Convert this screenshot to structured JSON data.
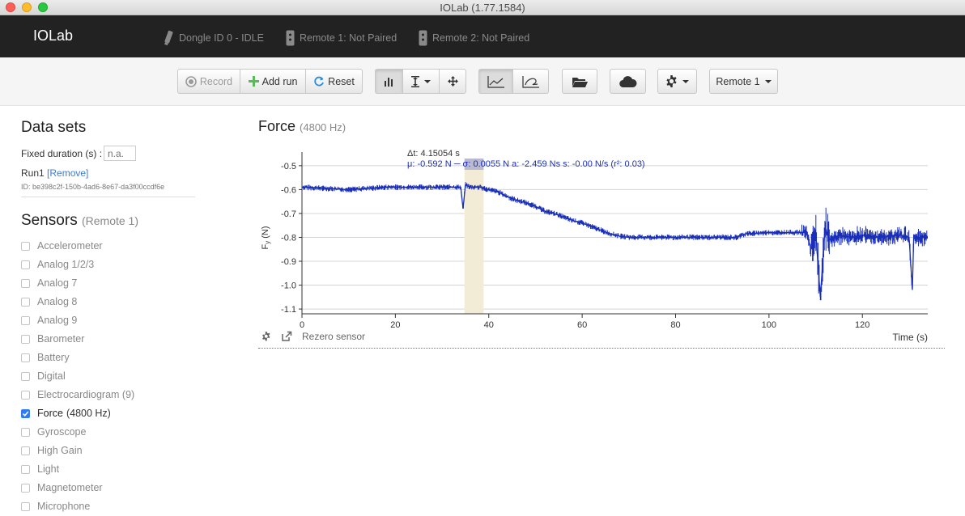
{
  "window": {
    "title": "IOLab (1.77.1584)"
  },
  "navbar": {
    "brand": "IOLab",
    "dongle": "Dongle ID 0 - IDLE",
    "remote1": "Remote 1: Not Paired",
    "remote2": "Remote 2: Not Paired"
  },
  "toolbar": {
    "record": "Record",
    "add_run": "Add run",
    "reset": "Reset",
    "remote_select": "Remote 1"
  },
  "datasets": {
    "heading": "Data sets",
    "fixed_duration_label": "Fixed duration (s) :",
    "fixed_duration_placeholder": "n.a.",
    "run_name": "Run1",
    "remove_link": "[Remove]",
    "run_id": "ID: be398c2f-150b-4ad6-8e67-da3f00ccdf6e"
  },
  "sensors": {
    "heading": "Sensors",
    "subheading": "(Remote 1)",
    "items": [
      {
        "name": "Accelerometer",
        "checked": false,
        "rate": ""
      },
      {
        "name": "Analog 1/2/3",
        "checked": false,
        "rate": ""
      },
      {
        "name": "Analog 7",
        "checked": false,
        "rate": ""
      },
      {
        "name": "Analog 8",
        "checked": false,
        "rate": ""
      },
      {
        "name": "Analog 9",
        "checked": false,
        "rate": ""
      },
      {
        "name": "Barometer",
        "checked": false,
        "rate": ""
      },
      {
        "name": "Battery",
        "checked": false,
        "rate": ""
      },
      {
        "name": "Digital",
        "checked": false,
        "rate": ""
      },
      {
        "name": "Electrocardiogram (9)",
        "checked": false,
        "rate": ""
      },
      {
        "name": "Force",
        "checked": true,
        "rate": "(4800 Hz)"
      },
      {
        "name": "Gyroscope",
        "checked": false,
        "rate": ""
      },
      {
        "name": "High Gain",
        "checked": false,
        "rate": ""
      },
      {
        "name": "Light",
        "checked": false,
        "rate": ""
      },
      {
        "name": "Magnetometer",
        "checked": false,
        "rate": ""
      },
      {
        "name": "Microphone",
        "checked": false,
        "rate": ""
      }
    ]
  },
  "plot": {
    "title": "Force",
    "rate": "(4800 Hz)",
    "rezero_label": "Rezero sensor",
    "stats_dt": "Δt: 4.15054 s",
    "stats_line": "μ: -0.592 N  ─  σ: 0.0055 N    a: -2.459 Ns    s: -0.00 N/s (r²: 0.03)"
  },
  "chart_data": {
    "type": "line",
    "xlabel": "Time (s)",
    "ylabel": "F",
    "ylabel_subscript": "y",
    "ylabel_unit": "(N)",
    "xlim": [
      0,
      134
    ],
    "ylim": [
      -1.12,
      -0.47
    ],
    "x_ticks": [
      0,
      20,
      40,
      60,
      80,
      100,
      120
    ],
    "y_ticks": [
      -0.5,
      -0.6,
      -0.7,
      -0.8,
      -0.9,
      -1.0,
      -1.1
    ],
    "grid": true,
    "line_color": "#1a2fb8",
    "selection": {
      "x_start": 34.8,
      "x_end": 38.9
    },
    "series": [
      {
        "x": [
          0,
          10,
          18,
          20,
          28,
          32,
          34,
          34.5,
          35,
          36,
          38,
          40,
          42,
          44,
          46,
          48,
          50,
          52,
          54,
          56,
          58,
          60,
          62,
          64,
          66,
          68,
          70,
          75,
          80,
          85,
          90,
          93,
          95,
          100,
          105,
          108,
          109,
          110,
          111,
          112,
          113,
          115,
          118,
          120,
          124,
          128,
          130,
          130.7,
          131,
          132,
          134
        ],
        "y": [
          -0.59,
          -0.6,
          -0.59,
          -0.59,
          -0.59,
          -0.59,
          -0.59,
          -0.68,
          -0.58,
          -0.59,
          -0.59,
          -0.6,
          -0.61,
          -0.63,
          -0.645,
          -0.655,
          -0.67,
          -0.69,
          -0.7,
          -0.715,
          -0.73,
          -0.74,
          -0.755,
          -0.77,
          -0.785,
          -0.795,
          -0.8,
          -0.8,
          -0.8,
          -0.8,
          -0.8,
          -0.8,
          -0.785,
          -0.78,
          -0.78,
          -0.78,
          -0.85,
          -0.78,
          -1.05,
          -0.76,
          -0.81,
          -0.79,
          -0.8,
          -0.79,
          -0.8,
          -0.79,
          -0.8,
          -1.02,
          -0.79,
          -0.8,
          -0.8
        ]
      }
    ]
  }
}
